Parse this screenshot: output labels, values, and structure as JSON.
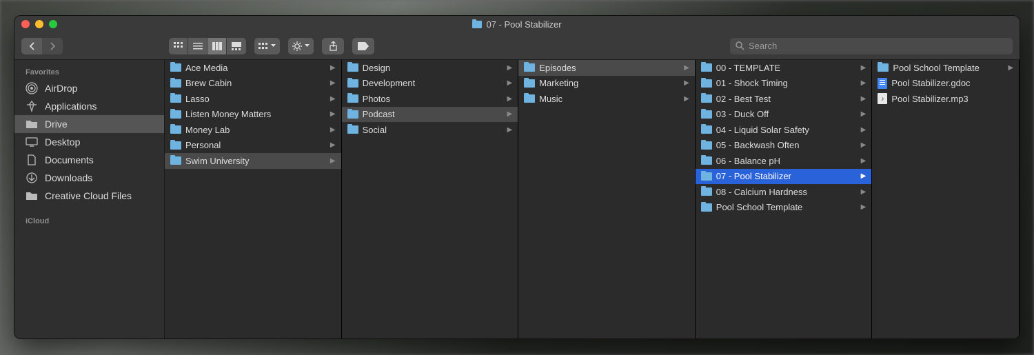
{
  "window": {
    "title": "07 - Pool Stabilizer"
  },
  "toolbar": {
    "search_placeholder": "Search"
  },
  "sidebar": {
    "sections": [
      {
        "header": "Favorites",
        "items": [
          {
            "icon": "airdrop",
            "label": "AirDrop"
          },
          {
            "icon": "apps",
            "label": "Applications"
          },
          {
            "icon": "folder",
            "label": "Drive",
            "selected": true
          },
          {
            "icon": "desktop",
            "label": "Desktop"
          },
          {
            "icon": "docs",
            "label": "Documents"
          },
          {
            "icon": "downloads",
            "label": "Downloads"
          },
          {
            "icon": "folder",
            "label": "Creative Cloud Files"
          }
        ]
      },
      {
        "header": "iCloud",
        "items": []
      }
    ]
  },
  "columns": [
    [
      {
        "type": "folder",
        "label": "Ace Media",
        "hasChildren": true
      },
      {
        "type": "folder",
        "label": "Brew Cabin",
        "hasChildren": true
      },
      {
        "type": "folder",
        "label": "Lasso",
        "hasChildren": true
      },
      {
        "type": "folder",
        "label": "Listen Money Matters",
        "hasChildren": true
      },
      {
        "type": "folder",
        "label": "Money Lab",
        "hasChildren": true
      },
      {
        "type": "folder",
        "label": "Personal",
        "hasChildren": true
      },
      {
        "type": "folder",
        "label": "Swim University",
        "hasChildren": true,
        "selected": true
      }
    ],
    [
      {
        "type": "folder",
        "label": "Design",
        "hasChildren": true
      },
      {
        "type": "folder",
        "label": "Development",
        "hasChildren": true
      },
      {
        "type": "folder",
        "label": "Photos",
        "hasChildren": true
      },
      {
        "type": "folder",
        "label": "Podcast",
        "hasChildren": true,
        "selected": true
      },
      {
        "type": "folder",
        "label": "Social",
        "hasChildren": true
      }
    ],
    [
      {
        "type": "folder",
        "label": "Episodes",
        "hasChildren": true,
        "selected": true
      },
      {
        "type": "folder",
        "label": "Marketing",
        "hasChildren": true
      },
      {
        "type": "folder",
        "label": "Music",
        "hasChildren": true
      }
    ],
    [
      {
        "type": "folder",
        "label": "00 - TEMPLATE",
        "hasChildren": true
      },
      {
        "type": "folder",
        "label": "01 - Shock Timing",
        "hasChildren": true
      },
      {
        "type": "folder",
        "label": "02 - Best Test",
        "hasChildren": true
      },
      {
        "type": "folder",
        "label": "03 - Duck Off",
        "hasChildren": true
      },
      {
        "type": "folder",
        "label": "04 - Liquid Solar Safety",
        "hasChildren": true
      },
      {
        "type": "folder",
        "label": "05 - Backwash Often",
        "hasChildren": true
      },
      {
        "type": "folder",
        "label": "06 - Balance pH",
        "hasChildren": true
      },
      {
        "type": "folder",
        "label": "07 - Pool Stabilizer",
        "hasChildren": true,
        "active": true
      },
      {
        "type": "folder",
        "label": "08 - Calcium Hardness",
        "hasChildren": true
      },
      {
        "type": "folder",
        "label": "Pool School Template",
        "hasChildren": true
      }
    ],
    [
      {
        "type": "folder",
        "label": "Pool School Template",
        "hasChildren": true
      },
      {
        "type": "gdoc",
        "label": "Pool Stabilizer.gdoc"
      },
      {
        "type": "audio",
        "label": "Pool Stabilizer.mp3"
      }
    ]
  ]
}
